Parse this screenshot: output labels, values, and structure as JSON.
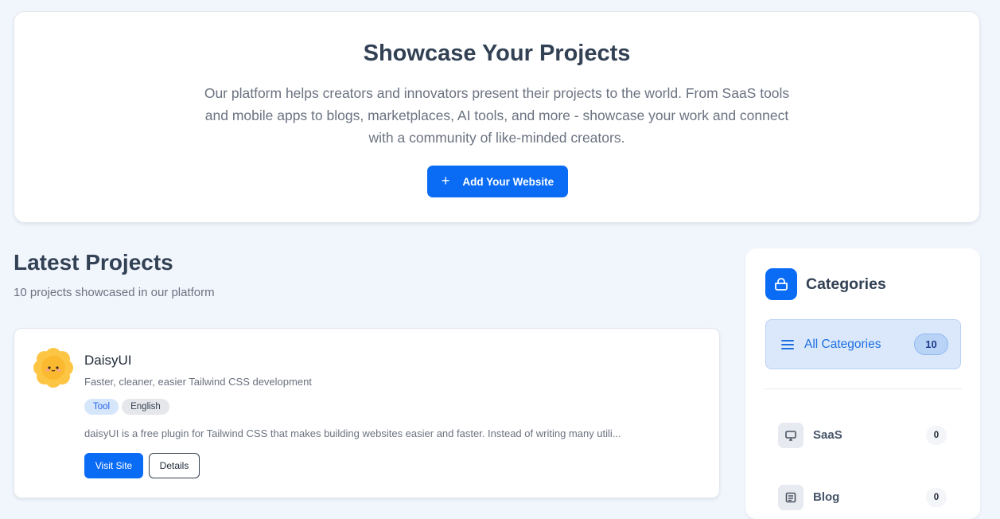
{
  "hero": {
    "title": "Showcase Your Projects",
    "description": "Our platform helps creators and innovators present their projects to the world. From SaaS tools and mobile apps to blogs, marketplaces, AI tools, and more - showcase your work and connect with a community of like-minded creators.",
    "button_label": "Add Your Website",
    "button_icon": "plus-icon",
    "accent_color": "#0a6cf5"
  },
  "latest": {
    "title": "Latest Projects",
    "subtitle": "10 projects showcased in our platform"
  },
  "projects": [
    {
      "name": "DaisyUI",
      "tagline": "Faster, cleaner, easier Tailwind CSS development",
      "tags": [
        "Tool",
        "English"
      ],
      "description": "daisyUI is a free plugin for Tailwind CSS that makes building websites easier and faster. Instead of writing many utili...",
      "visit_label": "Visit Site",
      "details_label": "Details",
      "logo_icon": "daisy-flower-logo"
    }
  ],
  "sidebar": {
    "title": "Categories",
    "title_icon": "basket-icon",
    "all": {
      "label": "All Categories",
      "count": "10",
      "icon": "list-icon"
    },
    "categories": [
      {
        "label": "SaaS",
        "count": "0",
        "icon": "monitor-icon"
      },
      {
        "label": "Blog",
        "count": "0",
        "icon": "newspaper-icon"
      }
    ]
  }
}
